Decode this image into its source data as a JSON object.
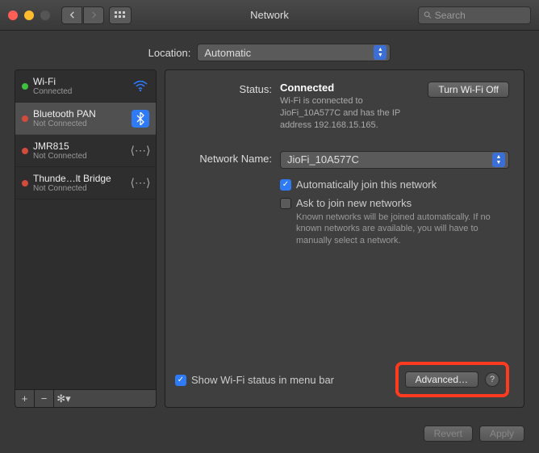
{
  "window": {
    "title": "Network"
  },
  "search": {
    "placeholder": "Search"
  },
  "location": {
    "label": "Location:",
    "value": "Automatic"
  },
  "services": [
    {
      "name": "Wi-Fi",
      "status": "Connected",
      "dot": "green",
      "icon": "wifi",
      "selected": false
    },
    {
      "name": "Bluetooth PAN",
      "status": "Not Connected",
      "dot": "red",
      "icon": "bluetooth",
      "selected": true
    },
    {
      "name": "JMR815",
      "status": "Not Connected",
      "dot": "red",
      "icon": "link",
      "selected": false
    },
    {
      "name": "Thunde…lt Bridge",
      "status": "Not Connected",
      "dot": "red",
      "icon": "link",
      "selected": false
    }
  ],
  "sidebar_buttons": {
    "add": "+",
    "remove": "−",
    "gear": "✻▾"
  },
  "detail": {
    "status_label": "Status:",
    "status_value": "Connected",
    "turn_off": "Turn Wi-Fi Off",
    "status_sub": "Wi-Fi is connected to JioFi_10A577C and has the IP address 192.168.15.165.",
    "network_label": "Network Name:",
    "network_value": "JioFi_10A577C",
    "auto_join": "Automatically join this network",
    "ask_join": "Ask to join new networks",
    "ask_hint": "Known networks will be joined automatically. If no known networks are available, you will have to manually select a network.",
    "show_menu": "Show Wi-Fi status in menu bar",
    "advanced": "Advanced…",
    "help": "?"
  },
  "footer": {
    "revert": "Revert",
    "apply": "Apply"
  }
}
